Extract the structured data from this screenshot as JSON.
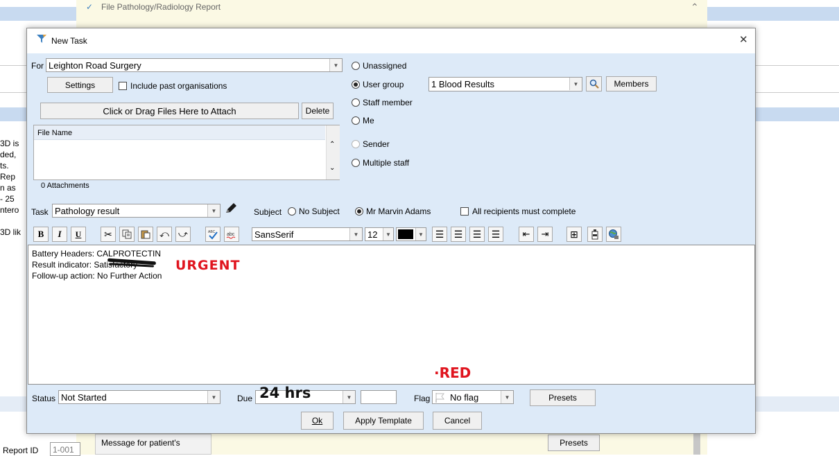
{
  "background_window": {
    "title": "File Pathology/Radiology Report",
    "side_text_lines": [
      "3D is",
      "ded,",
      "ts.",
      "Rep",
      "n as",
      "- 25",
      "ntero",
      "",
      "3D lik"
    ],
    "report_id_label": "Report ID",
    "report_id_value": "1-001",
    "message_label": "Message for patient's",
    "presets_label": "Presets"
  },
  "dialog": {
    "title": "New Task",
    "close_glyph": "✕",
    "for_label": "For",
    "for_value": "Leighton Road Surgery",
    "settings_label": "Settings",
    "include_past_label": "Include past organisations",
    "attach_label": "Click or Drag Files Here to Attach",
    "delete_label": "Delete",
    "file_table_header": "File Name",
    "attachments_count": "0 Attachments",
    "assignee": {
      "options": [
        {
          "label": "Unassigned",
          "selected": false,
          "enabled": true
        },
        {
          "label": "User group",
          "selected": true,
          "enabled": true
        },
        {
          "label": "Staff member",
          "selected": false,
          "enabled": true
        },
        {
          "label": "Me",
          "selected": false,
          "enabled": true
        },
        {
          "label": "Sender",
          "selected": false,
          "enabled": false
        },
        {
          "label": "Multiple staff",
          "selected": false,
          "enabled": true
        }
      ],
      "group_value": "1 Blood Results",
      "members_label": "Members"
    },
    "task_label": "Task",
    "task_value": "Pathology result",
    "subject_label": "Subject",
    "subject_options": [
      {
        "label": "No Subject",
        "selected": false
      },
      {
        "label": "Mr Marvin Adams",
        "selected": true
      }
    ],
    "all_recipients_label": "All recipients must complete",
    "toolbar": {
      "bold": "B",
      "italic": "I",
      "underline": "U",
      "font_value": "SansSerif",
      "size_value": "12",
      "text_color": "#000000"
    },
    "editor_lines": [
      "Battery Headers: CALPROTECTIN",
      "Result indicator: Satisfactory",
      "Follow-up action: No Further Action"
    ],
    "status_label": "Status",
    "status_value": "Not Started",
    "due_label": "Due",
    "flag_label": "Flag",
    "flag_value": "No flag",
    "presets_label": "Presets",
    "ok_label": "Ok",
    "apply_template_label": "Apply Template",
    "cancel_label": "Cancel"
  },
  "annotations": {
    "urgent": "URGENT",
    "red": "·RED",
    "due_handwriting": "24 hrs"
  },
  "colors": {
    "dialog_bg": "#ddeaf8",
    "title_bar_bg": "#ffffff",
    "annotation_red": "#e0141e",
    "background_band": "#c8daf0"
  }
}
